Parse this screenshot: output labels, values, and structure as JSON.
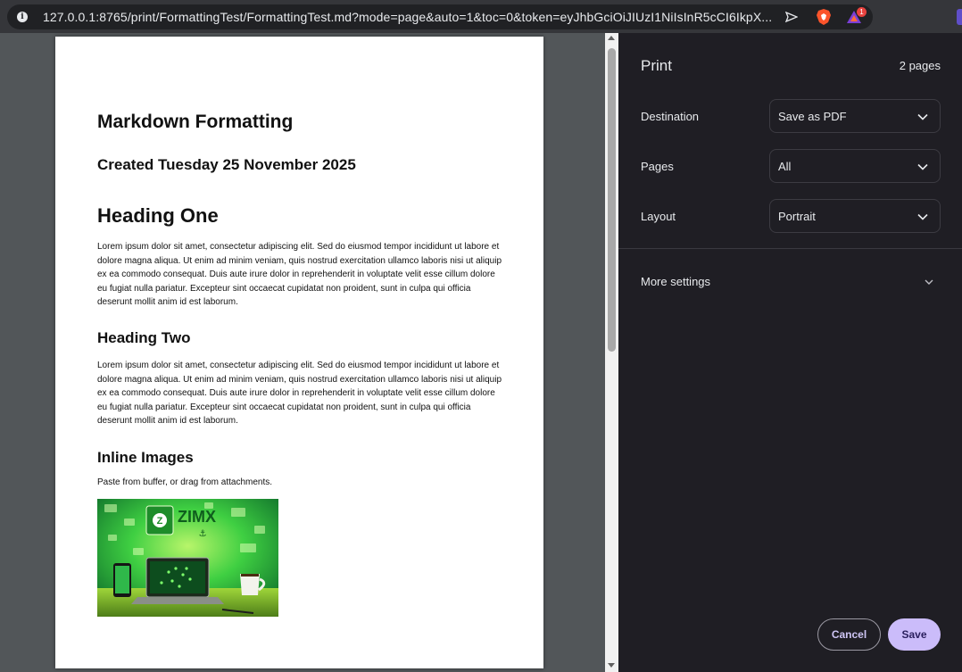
{
  "browser": {
    "url": "127.0.0.1:8765/print/FormattingTest/FormattingTest.md?mode=page&auto=1&toc=0&token=eyJhbGciOiJIUzI1NiIsInR5cCI6IkpX...",
    "rewards_badge": "1"
  },
  "document": {
    "title": "Markdown Formatting",
    "created": "Created Tuesday 25 November 2025",
    "heading_one": "Heading One",
    "paragraph_one": "Lorem ipsum dolor sit amet, consectetur adipiscing elit. Sed do eiusmod tempor incididunt ut labore et dolore magna aliqua. Ut enim ad minim veniam, quis nostrud exercitation ullamco laboris nisi ut aliquip ex ea commodo consequat. Duis aute irure dolor in reprehenderit in voluptate velit esse cillum dolore eu fugiat nulla pariatur. Excepteur sint occaecat cupidatat non proident, sunt in culpa qui officia deserunt mollit anim id est laborum.",
    "heading_two": "Heading Two",
    "paragraph_two": "Lorem ipsum dolor sit amet, consectetur adipiscing elit. Sed do eiusmod tempor incididunt ut labore et dolore magna aliqua. Ut enim ad minim veniam, quis nostrud exercitation ullamco laboris nisi ut aliquip ex ea commodo consequat. Duis aute irure dolor in reprehenderit in voluptate velit esse cillum dolore eu fugiat nulla pariatur. Excepteur sint occaecat cupidatat non proident, sunt in culpa qui officia deserunt mollit anim id est laborum.",
    "heading_images": "Inline Images",
    "images_caption": "Paste from buffer, or drag from attachments.",
    "image_logo_text": "ZIMX"
  },
  "print_panel": {
    "title": "Print",
    "page_count": "2 pages",
    "destination_label": "Destination",
    "destination_value": "Save as PDF",
    "pages_label": "Pages",
    "pages_value": "All",
    "layout_label": "Layout",
    "layout_value": "Portrait",
    "more_settings_label": "More settings",
    "cancel_label": "Cancel",
    "save_label": "Save"
  },
  "colors": {
    "panel_bg": "#1f1e24",
    "preview_bg": "#525659",
    "save_button": "#cbbcfa",
    "image_green": "#3ecf3e"
  }
}
